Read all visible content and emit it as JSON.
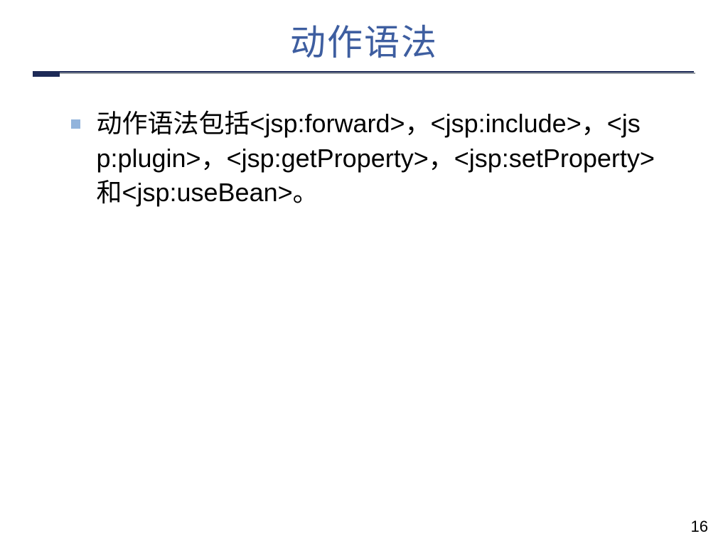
{
  "title": "动作语法",
  "bullet_text": "动作语法包括<jsp:forward>，<jsp:include>，<jsp:plugin>，<jsp:getProperty>，<jsp:setProperty>和<jsp:useBean>。",
  "page_number": "16"
}
